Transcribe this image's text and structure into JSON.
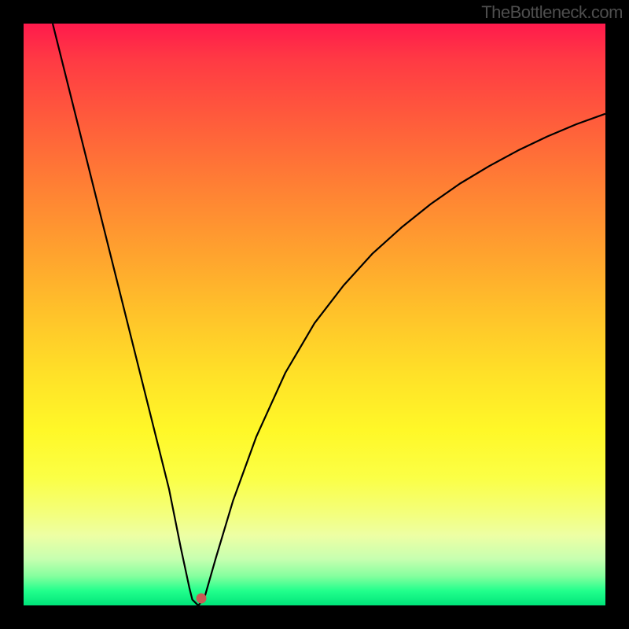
{
  "watermark": "TheBottleneck.com",
  "chart_data": {
    "type": "line",
    "title": "",
    "xlabel": "",
    "ylabel": "",
    "x_range": [
      0,
      100
    ],
    "y_range": [
      0,
      100
    ],
    "curve": {
      "description": "V-shaped bottleneck curve; steep linear descent from top-left to a minimum near x≈30, then concave rise toward the right",
      "minimum_x_pct": 30,
      "minimum_y_pct": 0,
      "points_pct": [
        [
          5,
          100
        ],
        [
          10,
          80
        ],
        [
          15,
          60
        ],
        [
          20,
          40
        ],
        [
          25,
          20
        ],
        [
          27,
          10
        ],
        [
          28.5,
          3
        ],
        [
          29,
          1
        ],
        [
          30,
          0
        ],
        [
          31,
          1
        ],
        [
          33,
          8
        ],
        [
          36,
          18
        ],
        [
          40,
          29
        ],
        [
          45,
          40
        ],
        [
          50,
          48.5
        ],
        [
          55,
          55
        ],
        [
          60,
          60.5
        ],
        [
          65,
          65
        ],
        [
          70,
          69
        ],
        [
          75,
          72.5
        ],
        [
          80,
          75.5
        ],
        [
          85,
          78.2
        ],
        [
          90,
          80.6
        ],
        [
          95,
          82.7
        ],
        [
          100,
          84.5
        ]
      ]
    },
    "marker": {
      "x_pct": 30.5,
      "y_pct": 1.2,
      "color": "#c85b55"
    },
    "background_gradient": {
      "top_color": "#ff1a4c",
      "mid_color": "#ffe028",
      "bottom_color": "#00e47a"
    }
  }
}
